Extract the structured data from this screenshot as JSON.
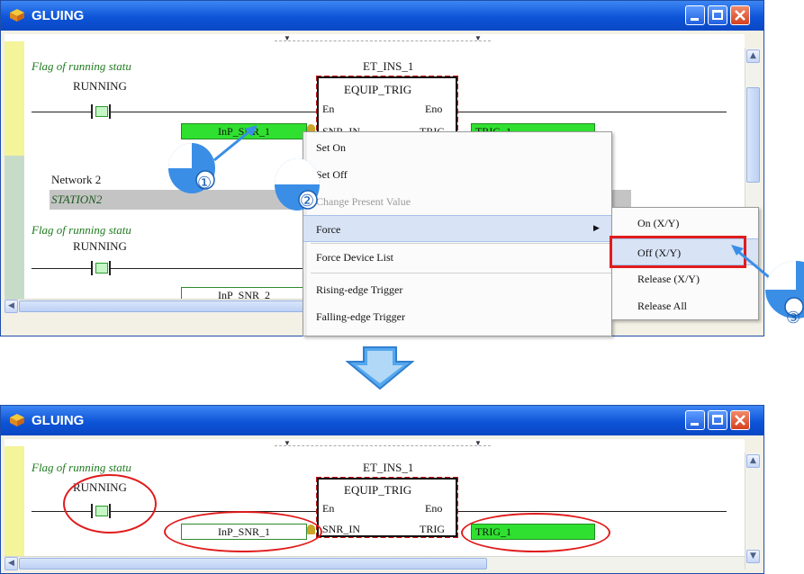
{
  "top_window": {
    "title": "GLUING",
    "network1": {
      "flag_comment": "Flag of running statu",
      "contact_label": "RUNNING",
      "fb_instance": "ET_INS_1",
      "fb_type": "EQUIP_TRIG",
      "pin_en": "En",
      "pin_eno": "Eno",
      "pin_in": "SNR_IN",
      "pin_out": "TRIG",
      "input_var": "InP_SNR_1",
      "output_var": "TRIG_1"
    },
    "network2": {
      "header": "Network 2",
      "station": "STATION2",
      "flag_comment": "Flag of running statu",
      "contact_label": "RUNNING",
      "input_var": "InP_SNR_2"
    },
    "context_menu": {
      "items": [
        "Set On",
        "Set Off",
        "Change Present Value",
        "Force",
        "Force Device List",
        "Rising-edge Trigger",
        "Falling-edge Trigger"
      ],
      "disabled": "Change Present Value",
      "submenu_arrow": "▶"
    },
    "submenu": {
      "items": [
        "On (X/Y)",
        "Off (X/Y)",
        "Release (X/Y)",
        "Release All"
      ]
    },
    "steps": [
      "①",
      "②",
      "③"
    ]
  },
  "bottom_window": {
    "title": "GLUING",
    "flag_comment": "Flag of running statu",
    "contact_label": "RUNNING",
    "fb_instance": "ET_INS_1",
    "fb_type": "EQUIP_TRIG",
    "pin_en": "En",
    "pin_eno": "Eno",
    "pin_in": "SNR_IN",
    "pin_out": "TRIG",
    "input_var": "InP_SNR_1",
    "output_var": "TRIG_1"
  },
  "colors": {
    "title_blue": "#0d54d8",
    "accent_red": "#e01c1c",
    "tag_green": "#30e030",
    "arrow_blue": "#3a8ee6"
  }
}
